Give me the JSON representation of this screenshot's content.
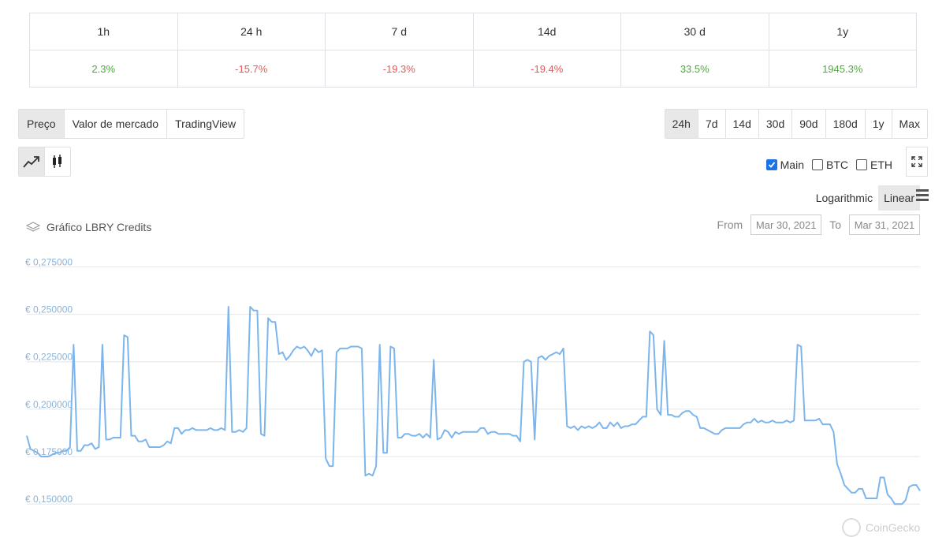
{
  "performance": {
    "headers": [
      "1h",
      "24 h",
      "7 d",
      "14d",
      "30 d",
      "1y"
    ],
    "values": [
      "2.3%",
      "-15.7%",
      "-19.3%",
      "-19.4%",
      "33.5%",
      "1945.3%"
    ],
    "positive_color": "#4fa83d",
    "negative_color": "#e35a5a"
  },
  "view_tabs": [
    "Preço",
    "Valor de mercado",
    "TradingView"
  ],
  "range_tabs": [
    "24h",
    "7d",
    "14d",
    "30d",
    "90d",
    "180d",
    "1y",
    "Max"
  ],
  "chart_type_icons": [
    "line-chart-icon",
    "candlestick-icon"
  ],
  "compare": [
    {
      "label": "Main",
      "checked": true
    },
    {
      "label": "BTC",
      "checked": false
    },
    {
      "label": "ETH",
      "checked": false
    }
  ],
  "scale": {
    "log_label": "Logarithmic",
    "linear_label": "Linear",
    "active": "Linear"
  },
  "chart_title": "Gráfico LBRY Credits",
  "date_range": {
    "from_label": "From",
    "from_value": "Mar 30, 2021",
    "to_label": "To",
    "to_value": "Mar 31, 2021"
  },
  "credit": "CoinGecko",
  "chart_data": {
    "type": "line",
    "title": "",
    "ylim": [
      0.148,
      0.281
    ],
    "yticks": [
      0.15,
      0.175,
      0.2,
      0.225,
      0.25,
      0.275
    ],
    "ytick_labels": [
      "€ 0,150000",
      "€ 0,175000",
      "€ 0,200000",
      "€ 0,225000",
      "€ 0,250000",
      "€ 0,275000"
    ],
    "grid": true,
    "line_color": "#7cb5ec",
    "series": [
      {
        "values": [
          0.186,
          0.179,
          0.178,
          0.177,
          0.175,
          0.175,
          0.175,
          0.176,
          0.177,
          0.177,
          0.178,
          0.178,
          0.18,
          0.234,
          0.178,
          0.178,
          0.181,
          0.181,
          0.182,
          0.179,
          0.18,
          0.234,
          0.184,
          0.184,
          0.185,
          0.185,
          0.185,
          0.239,
          0.238,
          0.186,
          0.186,
          0.183,
          0.183,
          0.184,
          0.18,
          0.18,
          0.18,
          0.18,
          0.181,
          0.183,
          0.182,
          0.19,
          0.19,
          0.187,
          0.189,
          0.189,
          0.19,
          0.189,
          0.189,
          0.189,
          0.189,
          0.19,
          0.189,
          0.189,
          0.19,
          0.189,
          0.254,
          0.188,
          0.188,
          0.189,
          0.188,
          0.19,
          0.254,
          0.252,
          0.252,
          0.187,
          0.186,
          0.248,
          0.246,
          0.246,
          0.229,
          0.23,
          0.226,
          0.228,
          0.231,
          0.233,
          0.232,
          0.233,
          0.231,
          0.228,
          0.232,
          0.23,
          0.231,
          0.174,
          0.17,
          0.17,
          0.23,
          0.232,
          0.232,
          0.232,
          0.233,
          0.233,
          0.233,
          0.232,
          0.165,
          0.166,
          0.165,
          0.17,
          0.234,
          0.177,
          0.177,
          0.233,
          0.232,
          0.185,
          0.185,
          0.187,
          0.187,
          0.186,
          0.186,
          0.187,
          0.185,
          0.187,
          0.185,
          0.226,
          0.184,
          0.185,
          0.189,
          0.188,
          0.185,
          0.188,
          0.187,
          0.188,
          0.188,
          0.188,
          0.188,
          0.188,
          0.19,
          0.19,
          0.187,
          0.188,
          0.188,
          0.187,
          0.187,
          0.187,
          0.187,
          0.186,
          0.186,
          0.183,
          0.225,
          0.226,
          0.225,
          0.184,
          0.227,
          0.228,
          0.226,
          0.228,
          0.229,
          0.23,
          0.229,
          0.232,
          0.191,
          0.19,
          0.191,
          0.189,
          0.191,
          0.19,
          0.191,
          0.19,
          0.191,
          0.193,
          0.19,
          0.19,
          0.193,
          0.191,
          0.193,
          0.19,
          0.191,
          0.191,
          0.192,
          0.192,
          0.194,
          0.196,
          0.196,
          0.241,
          0.239,
          0.2,
          0.197,
          0.236,
          0.197,
          0.197,
          0.196,
          0.196,
          0.198,
          0.199,
          0.199,
          0.197,
          0.196,
          0.19,
          0.19,
          0.189,
          0.188,
          0.187,
          0.187,
          0.189,
          0.19,
          0.19,
          0.19,
          0.19,
          0.19,
          0.192,
          0.193,
          0.193,
          0.195,
          0.193,
          0.194,
          0.193,
          0.193,
          0.194,
          0.193,
          0.193,
          0.193,
          0.194,
          0.193,
          0.194,
          0.234,
          0.233,
          0.194,
          0.194,
          0.194,
          0.194,
          0.195,
          0.192,
          0.192,
          0.192,
          0.188,
          0.171,
          0.166,
          0.16,
          0.158,
          0.156,
          0.156,
          0.158,
          0.158,
          0.153,
          0.153,
          0.153,
          0.153,
          0.164,
          0.164,
          0.155,
          0.153,
          0.15,
          0.15,
          0.15,
          0.152,
          0.159,
          0.16,
          0.16,
          0.157
        ]
      }
    ]
  }
}
